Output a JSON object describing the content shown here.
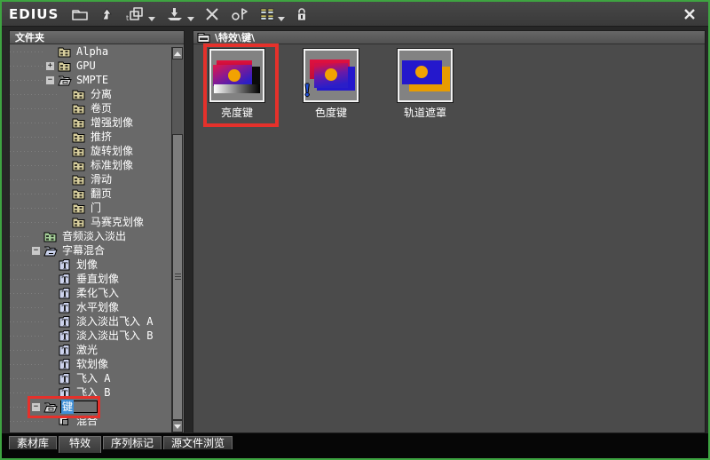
{
  "window": {
    "title": "EDIUS",
    "border_color": "#3ea441",
    "close_icon": "close-icon"
  },
  "toolbar": {
    "icons": [
      {
        "name": "new-folder-icon",
        "dropdown": false
      },
      {
        "name": "folder-up-icon",
        "dropdown": false
      },
      {
        "name": "duplicate-icon",
        "dropdown": true
      },
      {
        "name": "apply-to-timeline-icon",
        "dropdown": true
      },
      {
        "name": "delete-icon",
        "dropdown": false
      },
      {
        "name": "flag-circle-icon",
        "dropdown": false
      },
      {
        "name": "view-mode-icon",
        "dropdown": true
      },
      {
        "name": "lock-icon",
        "dropdown": false
      }
    ]
  },
  "left_panel": {
    "header": "文件夹",
    "tree": {
      "items": [
        {
          "label": "Alpha",
          "level": 2,
          "icon": "folder-film-icon",
          "expander": ""
        },
        {
          "label": "GPU",
          "level": 2,
          "icon": "folder-film-icon",
          "expander": "+"
        },
        {
          "label": "SMPTE",
          "level": 2,
          "icon": "folder-open-icon",
          "expander": "-"
        },
        {
          "label": "分离",
          "level": 3,
          "icon": "folder-film-icon",
          "expander": ""
        },
        {
          "label": "卷页",
          "level": 3,
          "icon": "folder-film-icon",
          "expander": ""
        },
        {
          "label": "增强划像",
          "level": 3,
          "icon": "folder-film-icon",
          "expander": ""
        },
        {
          "label": "推挤",
          "level": 3,
          "icon": "folder-film-icon",
          "expander": ""
        },
        {
          "label": "旋转划像",
          "level": 3,
          "icon": "folder-film-icon",
          "expander": ""
        },
        {
          "label": "标准划像",
          "level": 3,
          "icon": "folder-film-icon",
          "expander": ""
        },
        {
          "label": "滑动",
          "level": 3,
          "icon": "folder-film-icon",
          "expander": ""
        },
        {
          "label": "翻页",
          "level": 3,
          "icon": "folder-film-icon",
          "expander": ""
        },
        {
          "label": "门",
          "level": 3,
          "icon": "folder-film-icon",
          "expander": ""
        },
        {
          "label": "马赛克划像",
          "level": 3,
          "icon": "folder-film-icon",
          "expander": ""
        },
        {
          "label": "音频淡入淡出",
          "level": 1,
          "icon": "folder-audio-icon",
          "expander": ""
        },
        {
          "label": "字幕混合",
          "level": 1,
          "icon": "folder-open-blue-icon",
          "expander": "-"
        },
        {
          "label": "划像",
          "level": 2,
          "icon": "title-t-icon",
          "expander": ""
        },
        {
          "label": "垂直划像",
          "level": 2,
          "icon": "title-t-icon",
          "expander": ""
        },
        {
          "label": "柔化飞入",
          "level": 2,
          "icon": "title-t-icon",
          "expander": ""
        },
        {
          "label": "水平划像",
          "level": 2,
          "icon": "title-t-icon",
          "expander": ""
        },
        {
          "label": "淡入淡出飞入 A",
          "level": 2,
          "icon": "title-t-icon",
          "expander": ""
        },
        {
          "label": "淡入淡出飞入 B",
          "level": 2,
          "icon": "title-t-icon",
          "expander": ""
        },
        {
          "label": "激光",
          "level": 2,
          "icon": "title-t-icon",
          "expander": ""
        },
        {
          "label": "软划像",
          "level": 2,
          "icon": "title-t-icon",
          "expander": ""
        },
        {
          "label": "飞入 A",
          "level": 2,
          "icon": "title-t-icon",
          "expander": ""
        },
        {
          "label": "飞入 B",
          "level": 2,
          "icon": "title-t-icon",
          "expander": ""
        },
        {
          "label": "键",
          "level": 1,
          "icon": "folder-open-icon",
          "expander": "-",
          "selected": true,
          "editing": true
        },
        {
          "label": "混合",
          "level": 2,
          "icon": "blend-icon",
          "expander": ""
        }
      ]
    }
  },
  "right_panel": {
    "breadcrumb": {
      "path": "\\特效\\键\\",
      "icon": "folder-small-icon"
    },
    "items": [
      {
        "label": "亮度键",
        "thumb": "luma",
        "annotated": true
      },
      {
        "label": "色度键",
        "thumb": "chroma",
        "annotated": false,
        "badge": "!"
      },
      {
        "label": "轨道遮罩",
        "thumb": "matte",
        "annotated": false
      }
    ]
  },
  "bottom_tabs": {
    "tabs": [
      {
        "label": "素材库",
        "active": false
      },
      {
        "label": "特效",
        "active": true
      },
      {
        "label": "序列标记",
        "active": false
      },
      {
        "label": "源文件浏览",
        "active": false
      }
    ]
  },
  "colors": {
    "annotation": "#e5312b",
    "selection": "#3f8fd6",
    "window_border": "#3ea441"
  }
}
